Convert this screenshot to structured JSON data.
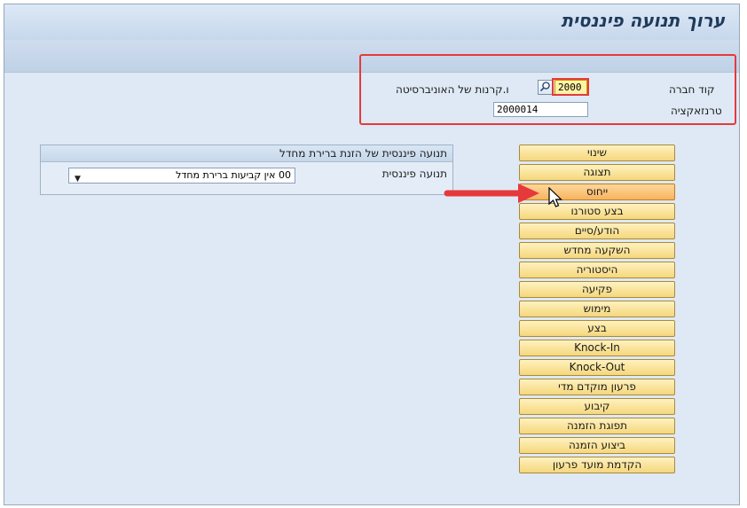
{
  "window": {
    "title": "ערוך תנועה פיננסית"
  },
  "header": {
    "company_code_label": "קוד חברה",
    "company_code_value": "2000",
    "company_name": "ו.קרנות של האוניברסיטה",
    "transaction_label": "טרנזאקציה",
    "transaction_value": "2000014"
  },
  "panel": {
    "title": "תנועה פיננסית של הזנת ברירת מחדל",
    "field_label": "תנועה פיננסית",
    "select_value": "00 אין קביעות ברירת מחדל"
  },
  "actions": [
    "שינוי",
    "תצוגה",
    "ייחוס",
    "בצע סטורנו",
    "הודע/סיים",
    "השקעה מחדש",
    "היסטוריה",
    "פקיעה",
    "מימוש",
    "בצע",
    "Knock-In",
    "Knock-Out",
    "פרעון מוקדם מדי",
    "קיבוע",
    "תפוגת הזמנה",
    "ביצוע הזמנה",
    "הקדמת מועד פרעון"
  ],
  "active_action_index": 2,
  "colors": {
    "highlight_box": "#e6393c",
    "button_fill": "#f5d77d",
    "title_text": "#1f3a5b"
  },
  "icons": [
    "search-icon",
    "dropdown-caret-icon",
    "red-arrow-icon",
    "mouse-pointer-icon"
  ]
}
